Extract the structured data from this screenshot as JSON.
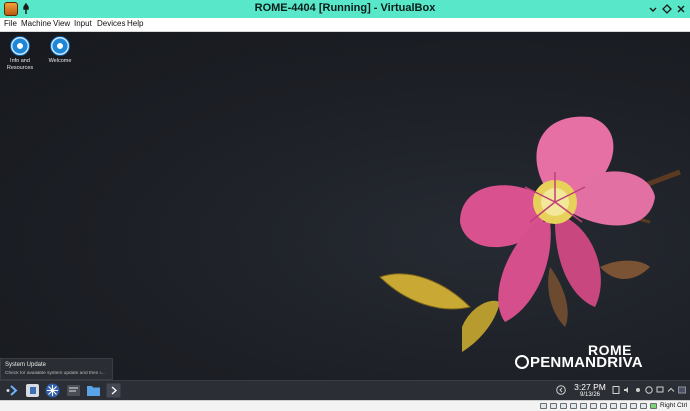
{
  "window": {
    "title": "ROME-4404 [Running] - VirtualBox"
  },
  "menu": [
    "File",
    "Machine",
    "View",
    "Input",
    "Devices",
    "Help"
  ],
  "desktop_icons": [
    {
      "label_line1": "Info and",
      "label_line2": "Resources"
    },
    {
      "label_line1": "Welcome",
      "label_line2": ""
    }
  ],
  "wallpaper": {
    "brand_top": "ROME",
    "brand_bottom": "PENMANDRIVA"
  },
  "notification": {
    "title": "System Update",
    "body": "Check for available system update and then i..."
  },
  "taskbar": {
    "time": "3:27 PM",
    "date": "9/13/26"
  },
  "statusbar": {
    "host_key": "Right Ctrl"
  },
  "colors": {
    "titlebar": "#58e7c8",
    "desktop": "#1c1f25",
    "taskbar": "#2b2e34"
  },
  "icons": [
    "virtualbox-icon",
    "pin-icon",
    "minimize-icon",
    "maximize-icon",
    "close-icon",
    "app-launcher-icon",
    "discover-icon",
    "settings-icon",
    "terminal-icon",
    "file-manager-icon",
    "volume-icon",
    "network-icon"
  ]
}
